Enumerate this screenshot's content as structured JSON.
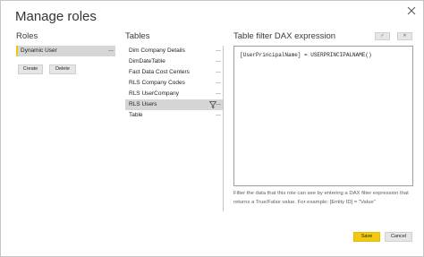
{
  "dialog": {
    "title": "Manage roles",
    "close_icon": "close-icon"
  },
  "roles": {
    "heading": "Roles",
    "items": [
      {
        "label": "Dynamic User",
        "more": "..."
      }
    ],
    "create_label": "Create",
    "delete_label": "Delete"
  },
  "tables": {
    "heading": "Tables",
    "items": [
      {
        "label": "Dim Company Details",
        "more": "..."
      },
      {
        "label": "DimDateTable",
        "more": "..."
      },
      {
        "label": "Fact Data Cost Centers",
        "more": "..."
      },
      {
        "label": "RLS Company Codes",
        "more": "..."
      },
      {
        "label": "RLS UserCompany",
        "more": "..."
      },
      {
        "label": "RLS Users",
        "more": "...",
        "selected": true,
        "filter_icon": "filter-icon"
      },
      {
        "label": "Table",
        "more": "..."
      }
    ]
  },
  "dax": {
    "heading": "Table filter DAX expression",
    "check_icon": "checkmark-icon",
    "undo_icon": "undo-icon",
    "check_label": "✓",
    "undo_label": "✕",
    "expression": "[UserPrincipalName] = USERPRINCIPALNAME()",
    "hint": "Filter the data that this role can see by entering a DAX filter expression that returns a True/False value. For example: [Entity ID] = \"Value\""
  },
  "footer": {
    "save_label": "Save",
    "cancel_label": "Cancel"
  },
  "colors": {
    "accent": "#f2c811",
    "selected_bg": "#d6d6d6",
    "button_bg": "#e6e6e6"
  }
}
